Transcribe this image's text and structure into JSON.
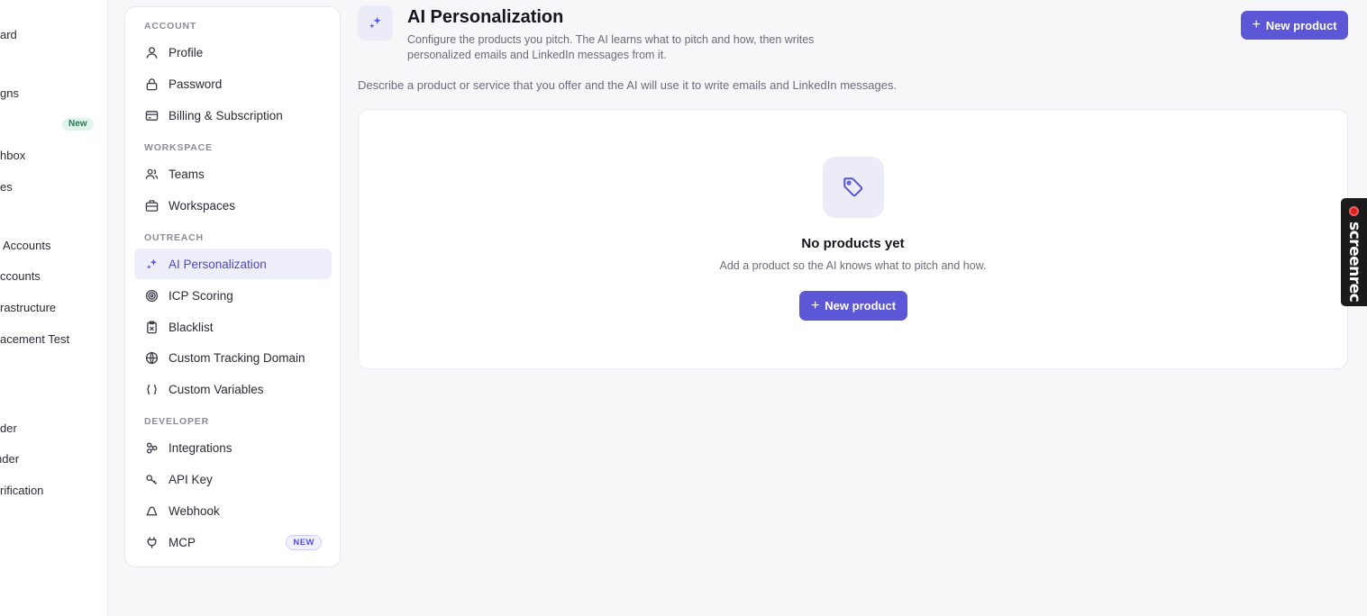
{
  "app_sidebar": {
    "items": [
      {
        "label": "ard"
      },
      {
        "label": "gns"
      },
      {
        "label": "hbox"
      },
      {
        "label": "es"
      },
      {
        "label": "Accounts"
      },
      {
        "label": "ccounts"
      },
      {
        "label": "rastructure"
      },
      {
        "label": "acement Test"
      },
      {
        "label": "der"
      },
      {
        "label": "nder"
      },
      {
        "label": "rification"
      }
    ],
    "new_badge": "New"
  },
  "settings_menu": {
    "sections": [
      {
        "label": "ACCOUNT"
      },
      {
        "label": "WORKSPACE"
      },
      {
        "label": "OUTREACH"
      },
      {
        "label": "DEVELOPER"
      }
    ],
    "items": [
      {
        "label": "Profile",
        "icon": "user-icon"
      },
      {
        "label": "Password",
        "icon": "lock-icon"
      },
      {
        "label": "Billing & Subscription",
        "icon": "credit-card-icon"
      },
      {
        "label": "Teams",
        "icon": "users-icon"
      },
      {
        "label": "Workspaces",
        "icon": "briefcase-icon"
      },
      {
        "label": "AI Personalization",
        "icon": "sparkles-icon",
        "active": true
      },
      {
        "label": "ICP Scoring",
        "icon": "target-icon"
      },
      {
        "label": "Blacklist",
        "icon": "clipboard-x-icon"
      },
      {
        "label": "Custom Tracking Domain",
        "icon": "globe-icon"
      },
      {
        "label": "Custom Variables",
        "icon": "braces-icon"
      },
      {
        "label": "Integrations",
        "icon": "integrations-icon"
      },
      {
        "label": "API Key",
        "icon": "key-icon"
      },
      {
        "label": "Webhook",
        "icon": "webhook-icon"
      },
      {
        "label": "MCP",
        "icon": "plug-icon",
        "badge": "NEW"
      }
    ]
  },
  "header": {
    "title": "AI Personalization",
    "subtitle": "Configure the products you pitch. The AI learns what to pitch and how, then writes personalized emails and LinkedIn messages from it.",
    "new_product_label": "New product"
  },
  "description": "Describe a product or service that you offer and the AI will use it to write emails and LinkedIn messages.",
  "empty_state": {
    "title": "No products yet",
    "text": "Add a product so the AI knows what to pitch and how.",
    "button_label": "New product"
  },
  "recorder": {
    "label": "screenrec"
  },
  "colors": {
    "accent": "#5b57d6",
    "active_bg": "#eeeefb",
    "page_bg": "#f7f7fa"
  }
}
